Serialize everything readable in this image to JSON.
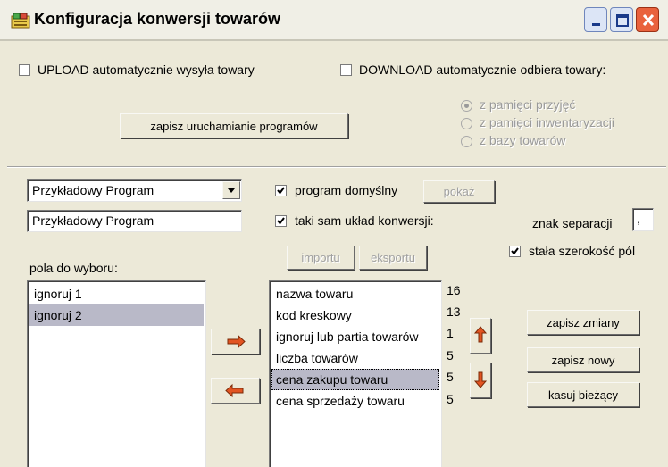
{
  "window": {
    "title": "Konfiguracja konwersji towarów",
    "icon": "app-icon",
    "controls": [
      "minimize-icon",
      "maximize-icon",
      "close-icon"
    ],
    "colors": {
      "close": "#e9623d",
      "arrow": "#e25422"
    }
  },
  "top": {
    "upload": {
      "label": "UPLOAD automatycznie wysyła towary",
      "checked": false
    },
    "download": {
      "label": "DOWNLOAD automatycznie odbiera towary:",
      "checked": false
    },
    "save_programs_button": "zapisz uruchamianie programów",
    "download_sources": [
      {
        "label": "z pamięci przyjęć",
        "selected": true
      },
      {
        "label": "z pamięci inwentaryzacji",
        "selected": false
      },
      {
        "label": "z bazy towarów",
        "selected": false
      }
    ]
  },
  "program": {
    "combo_value": "Przykładowy Program",
    "name_value": "Przykładowy Program",
    "default_program": {
      "label": "program domyślny",
      "checked": true
    },
    "show_button": "pokaż",
    "same_layout": {
      "label": "taki sam układ konwersji:",
      "checked": true
    },
    "import_button": "importu",
    "export_button": "eksportu",
    "separator_label": "znak separacji",
    "separator_value": ",",
    "fixed_width": {
      "label": "stała szerokość pól",
      "checked": true
    }
  },
  "available": {
    "label": "pola do wyboru:",
    "items": [
      "ignoruj 1",
      "ignoruj 2"
    ]
  },
  "selected_fields": {
    "items": [
      {
        "name": "nazwa towaru",
        "width": "16"
      },
      {
        "name": "kod kreskowy",
        "width": "13"
      },
      {
        "name": "ignoruj lub partia towarów",
        "width": "1"
      },
      {
        "name": "liczba towarów",
        "width": "5"
      },
      {
        "name": "cena zakupu towaru",
        "width": "5"
      },
      {
        "name": "cena sprzedaży towaru",
        "width": "5"
      }
    ]
  },
  "actions": {
    "save_changes": "zapisz zmiany",
    "save_new": "zapisz nowy",
    "delete_current": "kasuj bieżący"
  }
}
